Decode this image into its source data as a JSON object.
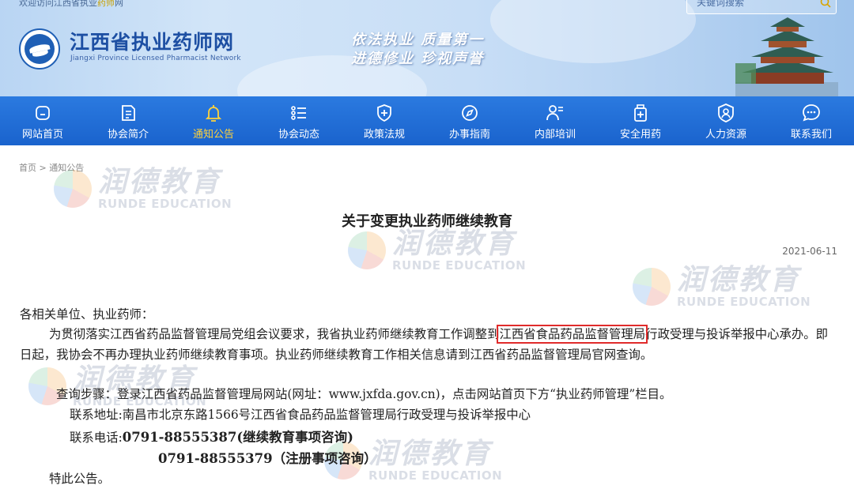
{
  "header": {
    "welcome_prefix": "欢迎访问江西省执业",
    "welcome_highlight": "药师",
    "welcome_suffix": "网",
    "site_title": "江西省执业药师网",
    "site_subtitle": "Jiangxi Province Licensed Pharmacist Network",
    "slogan_line1": "依法执业  质量第一",
    "slogan_line2": "进德修业  珍视声誉",
    "search": {
      "placeholder": "关键词搜索"
    }
  },
  "nav": {
    "items": [
      {
        "label": "网站首页",
        "icon": "home-icon"
      },
      {
        "label": "协会简介",
        "icon": "document-icon"
      },
      {
        "label": "通知公告",
        "icon": "bell-icon",
        "active": true
      },
      {
        "label": "协会动态",
        "icon": "list-icon"
      },
      {
        "label": "政策法规",
        "icon": "shield-plus-icon"
      },
      {
        "label": "办事指南",
        "icon": "compass-icon"
      },
      {
        "label": "内部培训",
        "icon": "person-training-icon"
      },
      {
        "label": "安全用药",
        "icon": "medicine-bottle-icon"
      },
      {
        "label": "人力资源",
        "icon": "person-badge-icon"
      },
      {
        "label": "联系我们",
        "icon": "chat-bubble-icon"
      }
    ],
    "active_color": "#ffd23a"
  },
  "breadcrumb": {
    "home": "首页",
    "separator": ">",
    "current": "通知公告"
  },
  "article": {
    "title": "关于变更执业药师继续教育",
    "date": "2021-06-11",
    "greeting": "各相关单位、执业药师：",
    "main_before": "为贯彻落实江西省药品监督管理局党组会议要求，我省执业药师继续教育工作调整到",
    "main_highlight": "江西省食品药品监督管理局",
    "main_after": "行政受理与投诉举报中心承办。即日起，我协会不再办理执业药师继续教育事项。执业药师继续教育工作相关信息请到江西省药品监督管理局官网查询。",
    "steps": "查询步骤：登录江西省药品监督管理局网站(网址：www.jxfda.gov.cn)，点击网站首页下方“执业药师管理”栏目。",
    "address": "联系地址:南昌市北京东路1566号江西省食品药品监督管理局行政受理与投诉举报中心",
    "tel_label": "联系电话:",
    "tel1": "0791-88555387(继续教育事项咨询)",
    "tel2": "0791-88555379（注册事项咨询）",
    "closing": "特此公告。"
  },
  "watermark": {
    "cn": "润德教育",
    "en": "RUNDE EDUCATION"
  },
  "colors": {
    "nav_blue": "#1f6fd8",
    "highlight_border": "#e02b2b",
    "title_blue": "#1d4fa3"
  }
}
